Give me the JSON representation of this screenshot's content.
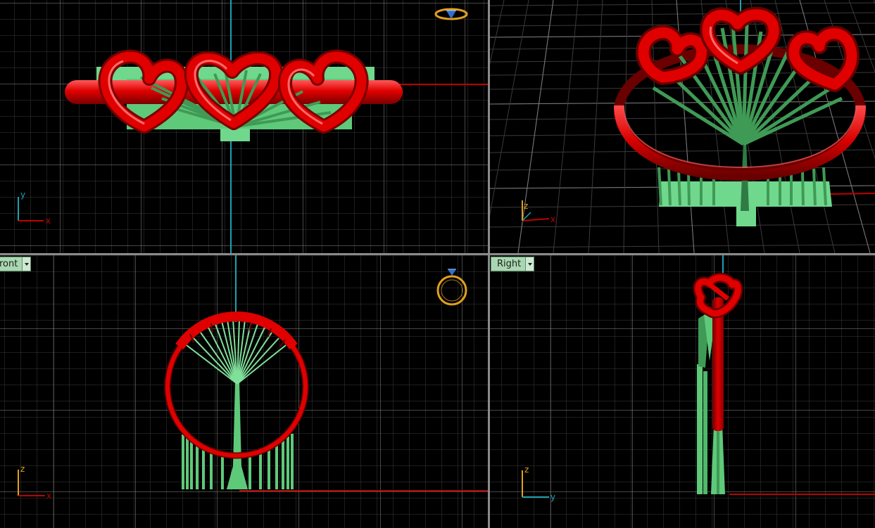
{
  "viewports": {
    "top": {
      "name": "top-viewport"
    },
    "perspective": {
      "name": "perspective-viewport"
    },
    "front": {
      "label": "ront",
      "name": "front-viewport"
    },
    "right": {
      "label": "Right",
      "name": "right-viewport"
    }
  },
  "axes": {
    "top": {
      "vertical": "y",
      "horizontal": "x"
    },
    "perspective": {
      "vertical": "z",
      "horizontal": "x"
    },
    "front": {
      "vertical": "z",
      "horizontal": "x"
    },
    "right": {
      "vertical": "z",
      "horizontal": "y"
    }
  },
  "colors": {
    "background": "#000000",
    "grid_minor": "#3a3a3a",
    "grid_major": "#8c8c8c",
    "ring": "#e00000",
    "support": "#5fc97a",
    "axis_x": "#c00000",
    "axis_vertical": "#1fa0b0",
    "gizmo": "#e0a020"
  },
  "icons": {
    "ring_gizmo": "ring-gizmo-icon",
    "dropdown": "chevron-down-icon"
  }
}
